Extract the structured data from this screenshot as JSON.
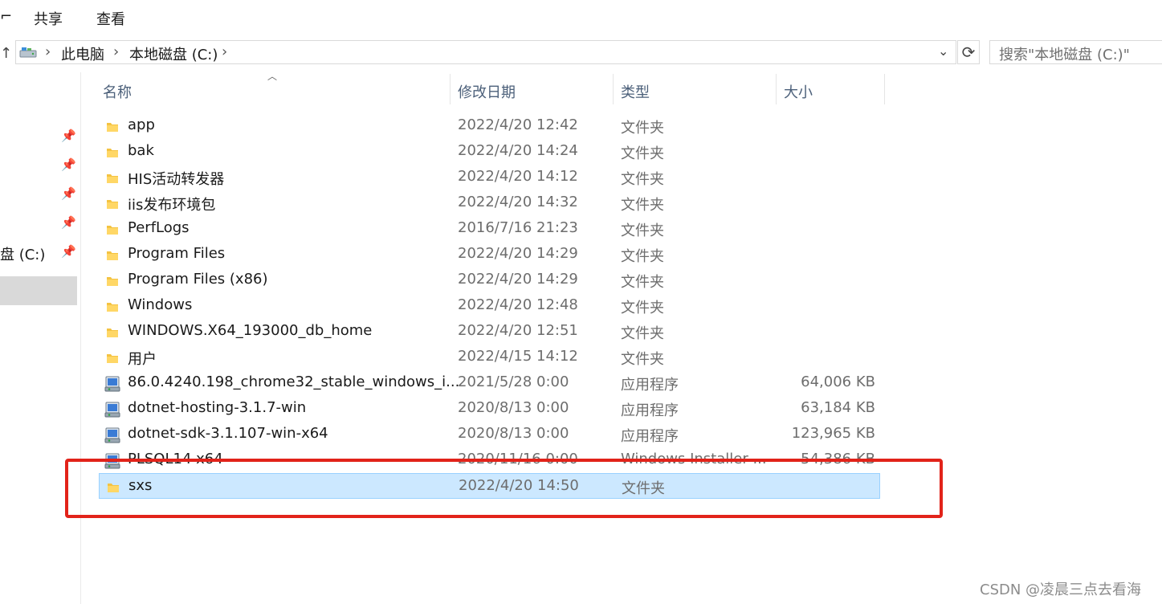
{
  "ribbon": {
    "tabs": [
      "共享",
      "查看"
    ]
  },
  "address_bar": {
    "crumbs": [
      "此电脑",
      "本地磁盘 (C:)"
    ],
    "search_placeholder": "搜索\"本地磁盘 (C:)\""
  },
  "nav_pane": {
    "drive_label": "盘 (C:)"
  },
  "columns": {
    "name": "名称",
    "date": "修改日期",
    "type": "类型",
    "size": "大小"
  },
  "files": [
    {
      "name": "app",
      "date": "2022/4/20 12:42",
      "type": "文件夹",
      "size": "",
      "icon": "folder-icon"
    },
    {
      "name": "bak",
      "date": "2022/4/20 14:24",
      "type": "文件夹",
      "size": "",
      "icon": "folder-icon"
    },
    {
      "name": "HIS活动转发器",
      "date": "2022/4/20 14:12",
      "type": "文件夹",
      "size": "",
      "icon": "folder-icon"
    },
    {
      "name": "iis发布环境包",
      "date": "2022/4/20 14:32",
      "type": "文件夹",
      "size": "",
      "icon": "folder-icon"
    },
    {
      "name": "PerfLogs",
      "date": "2016/7/16 21:23",
      "type": "文件夹",
      "size": "",
      "icon": "folder-icon"
    },
    {
      "name": "Program Files",
      "date": "2022/4/20 14:29",
      "type": "文件夹",
      "size": "",
      "icon": "folder-icon"
    },
    {
      "name": "Program Files (x86)",
      "date": "2022/4/20 14:29",
      "type": "文件夹",
      "size": "",
      "icon": "folder-icon"
    },
    {
      "name": "Windows",
      "date": "2022/4/20 12:48",
      "type": "文件夹",
      "size": "",
      "icon": "folder-icon"
    },
    {
      "name": "WINDOWS.X64_193000_db_home",
      "date": "2022/4/20 12:51",
      "type": "文件夹",
      "size": "",
      "icon": "folder-icon"
    },
    {
      "name": "用户",
      "date": "2022/4/15 14:12",
      "type": "文件夹",
      "size": "",
      "icon": "folder-icon"
    },
    {
      "name": "86.0.4240.198_chrome32_stable_windows_i...",
      "date": "2021/5/28 0:00",
      "type": "应用程序",
      "size": "64,006 KB",
      "icon": "installer-icon"
    },
    {
      "name": "dotnet-hosting-3.1.7-win",
      "date": "2020/8/13 0:00",
      "type": "应用程序",
      "size": "63,184 KB",
      "icon": "installer-icon"
    },
    {
      "name": "dotnet-sdk-3.1.107-win-x64",
      "date": "2020/8/13 0:00",
      "type": "应用程序",
      "size": "123,965 KB",
      "icon": "installer-icon"
    },
    {
      "name": "PLSQL14 x64",
      "date": "2020/11/16 0:00",
      "type": "Windows Installer ...",
      "size": "54,386 KB",
      "icon": "installer-icon"
    },
    {
      "name": "sxs",
      "date": "2022/4/20 14:50",
      "type": "文件夹",
      "size": "",
      "icon": "folder-icon",
      "selected": true
    }
  ],
  "colors": {
    "selection": "#cce8ff",
    "highlight_box": "#e2231a",
    "header_text": "#4c607a"
  },
  "watermark": "CSDN @凌晨三点去看海"
}
